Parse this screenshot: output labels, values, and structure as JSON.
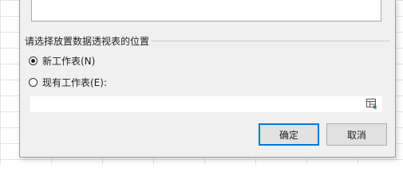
{
  "dialog": {
    "placement_group_label": "请选择放置数据透视表的位置",
    "options": [
      {
        "label": "新工作表(N)",
        "selected": true
      },
      {
        "label": "现有工作表(E):",
        "selected": false
      }
    ],
    "location_input": {
      "value": ""
    },
    "ok_label": "确定",
    "cancel_label": "取消",
    "accent_color": "#0078d7"
  }
}
